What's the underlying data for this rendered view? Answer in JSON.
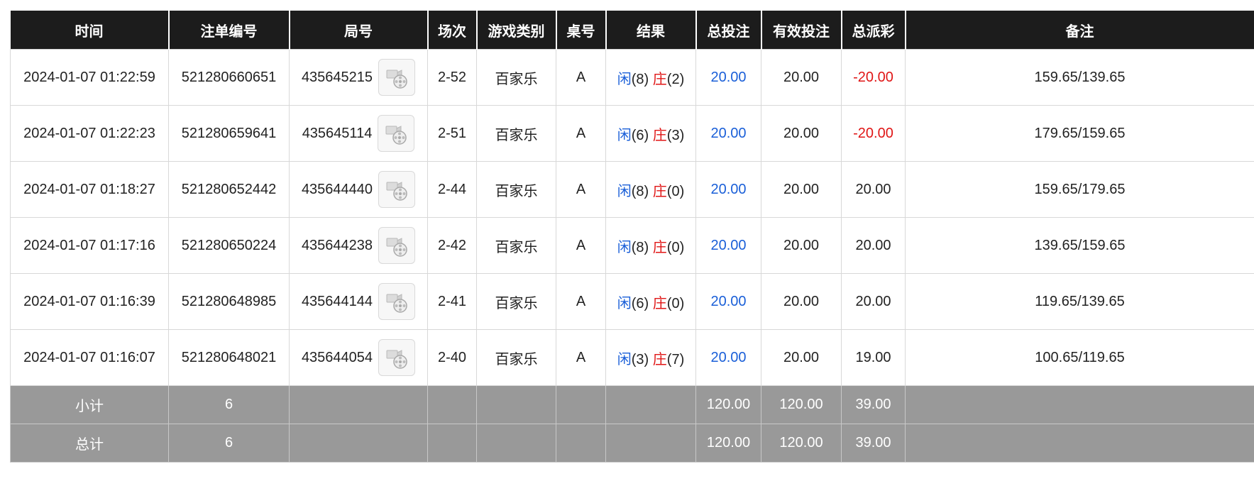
{
  "headers": [
    "时间",
    "注单编号",
    "局号",
    "场次",
    "游戏类别",
    "桌号",
    "结果",
    "总投注",
    "有效投注",
    "总派彩",
    "备注"
  ],
  "rows": [
    {
      "time": "2024-01-07 01:22:59",
      "bet_id": "521280660651",
      "round": "435645215",
      "session": "2-52",
      "game": "百家乐",
      "table": "A",
      "player_label": "闲",
      "player_score": "(8)",
      "banker_label": "庄",
      "banker_score": "(2)",
      "total_bet": "20.00",
      "valid_bet": "20.00",
      "payout": "-20.00",
      "payout_negative": true,
      "note": "159.65/139.65"
    },
    {
      "time": "2024-01-07 01:22:23",
      "bet_id": "521280659641",
      "round": "435645114",
      "session": "2-51",
      "game": "百家乐",
      "table": "A",
      "player_label": "闲",
      "player_score": "(6)",
      "banker_label": "庄",
      "banker_score": "(3)",
      "total_bet": "20.00",
      "valid_bet": "20.00",
      "payout": "-20.00",
      "payout_negative": true,
      "note": "179.65/159.65"
    },
    {
      "time": "2024-01-07 01:18:27",
      "bet_id": "521280652442",
      "round": "435644440",
      "session": "2-44",
      "game": "百家乐",
      "table": "A",
      "player_label": "闲",
      "player_score": "(8)",
      "banker_label": "庄",
      "banker_score": "(0)",
      "total_bet": "20.00",
      "valid_bet": "20.00",
      "payout": "20.00",
      "payout_negative": false,
      "note": "159.65/179.65"
    },
    {
      "time": "2024-01-07 01:17:16",
      "bet_id": "521280650224",
      "round": "435644238",
      "session": "2-42",
      "game": "百家乐",
      "table": "A",
      "player_label": "闲",
      "player_score": "(8)",
      "banker_label": "庄",
      "banker_score": "(0)",
      "total_bet": "20.00",
      "valid_bet": "20.00",
      "payout": "20.00",
      "payout_negative": false,
      "note": "139.65/159.65"
    },
    {
      "time": "2024-01-07 01:16:39",
      "bet_id": "521280648985",
      "round": "435644144",
      "session": "2-41",
      "game": "百家乐",
      "table": "A",
      "player_label": "闲",
      "player_score": "(6)",
      "banker_label": "庄",
      "banker_score": "(0)",
      "total_bet": "20.00",
      "valid_bet": "20.00",
      "payout": "20.00",
      "payout_negative": false,
      "note": "119.65/139.65"
    },
    {
      "time": "2024-01-07 01:16:07",
      "bet_id": "521280648021",
      "round": "435644054",
      "session": "2-40",
      "game": "百家乐",
      "table": "A",
      "player_label": "闲",
      "player_score": "(3)",
      "banker_label": "庄",
      "banker_score": "(7)",
      "total_bet": "20.00",
      "valid_bet": "20.00",
      "payout": "19.00",
      "payout_negative": false,
      "note": "100.65/119.65"
    }
  ],
  "subtotal": {
    "label": "小计",
    "count": "6",
    "total_bet": "120.00",
    "valid_bet": "120.00",
    "payout": "39.00"
  },
  "grand_total": {
    "label": "总计",
    "count": "6",
    "total_bet": "120.00",
    "valid_bet": "120.00",
    "payout": "39.00"
  },
  "icons": {
    "replay": "video-replay-icon"
  },
  "colors": {
    "header_bg": "#1c1c1c",
    "summary_bg": "#999999",
    "player": "#1a5fd8",
    "banker": "#e01616",
    "total_bet": "#1a5fd8",
    "negative": "#e01616"
  }
}
